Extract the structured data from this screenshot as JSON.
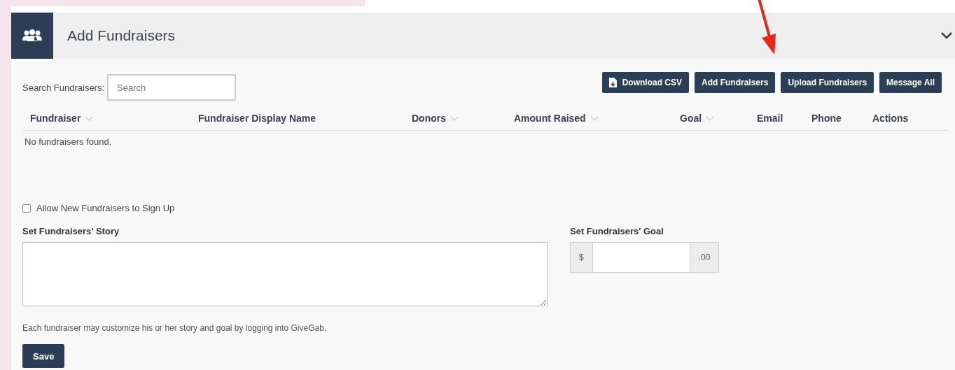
{
  "panel": {
    "title": "Add Fundraisers",
    "expanded": true
  },
  "search": {
    "label": "Search Fundraisers:",
    "placeholder": "Search"
  },
  "buttons": [
    {
      "label": "Download CSV",
      "icon": true
    },
    {
      "label": "Add Fundraisers",
      "icon": false
    },
    {
      "label": "Upload Fundraisers",
      "icon": false
    },
    {
      "label": "Message All",
      "icon": false
    }
  ],
  "table": {
    "columns": [
      {
        "label": "Fundraiser",
        "sortable": true
      },
      {
        "label": "Fundraiser Display Name",
        "sortable": false
      },
      {
        "label": "Donors",
        "sortable": true
      },
      {
        "label": "Amount Raised",
        "sortable": true
      },
      {
        "label": "Goal",
        "sortable": true
      },
      {
        "label": "Email",
        "sortable": false
      },
      {
        "label": "Phone",
        "sortable": false
      },
      {
        "label": "Actions",
        "sortable": false
      }
    ],
    "empty_message": "No fundraisers found."
  },
  "signup": {
    "label": "Allow New Fundraisers to Sign Up",
    "checked": false
  },
  "story": {
    "label": "Set Fundraisers' Story"
  },
  "goal": {
    "label": "Set Fundraisers' Goal",
    "prefix": "$",
    "suffix": ".00"
  },
  "help": "Each fundraiser may customize his or her story and goal by logging into GiveGab.",
  "save": "Save"
}
